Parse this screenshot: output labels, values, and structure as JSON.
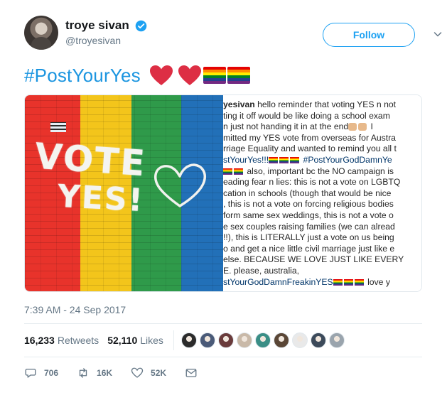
{
  "author": {
    "display_name": "troye sivan",
    "handle": "@troyesivan",
    "follow_label": "Follow"
  },
  "tweet": {
    "hashtag": "#PostYourYes",
    "emoji": [
      "heart-icon",
      "heart-icon",
      "rainbow-flag-icon",
      "rainbow-flag-icon"
    ]
  },
  "media": {
    "photo_text": [
      "VOTE",
      "YES!"
    ],
    "stripe_colors": [
      "#e8332b",
      "#f3c51b",
      "#2f9a4a",
      "#2270b8"
    ],
    "caption_lines": [
      {
        "bold": "yesivan",
        "text": " hello reminder that voting YES n not"
      },
      {
        "text": "ting it off would be like doing a school exam"
      },
      {
        "text": "n just not handing it in at the end",
        "trail": " I"
      },
      {
        "text": "mitted my YES vote from overseas for Austra"
      },
      {
        "text": "rriage Equality and wanted to remind you all t"
      },
      {
        "tag": "stYourYes!!!",
        "tag2": " #PostYourGodDamnYe"
      },
      {
        "text": " also, important bc the NO campaign is"
      },
      {
        "text": "eading fear n lies: this is not a vote on LGBTQ"
      },
      {
        "text": "cation in schools (though that would be nice"
      },
      {
        "text": ", this is not a vote on forcing religious bodies"
      },
      {
        "text": "form same sex weddings, this is not a vote o"
      },
      {
        "text": "e sex couples raising families (we can alread"
      },
      {
        "text": "!!), this is LITERALLY just a vote on us being"
      },
      {
        "text": "o and get a nice little civil marriage just like e"
      },
      {
        "text": "else. BECAUSE WE LOVE JUST LIKE EVERY"
      },
      {
        "text": "E. please, australia,"
      },
      {
        "tag": "stYourGodDamnFreakinYES",
        "trail": " love y"
      }
    ]
  },
  "timestamp": "7:39 AM - 24 Sep 2017",
  "stats": {
    "retweets_count": "16,233",
    "retweets_label": "Retweets",
    "likes_count": "52,110",
    "likes_label": "Likes",
    "liker_avatar_colors": [
      "#2b2b2b",
      "#4a5a78",
      "#6a3b3b",
      "#c9b9a8",
      "#3a8e86",
      "#5a4636",
      "#e9e9e9",
      "#3c4a5a",
      "#9aa4ad"
    ]
  },
  "actions": {
    "replies": "706",
    "retweets": "16K",
    "likes": "52K"
  },
  "colors": {
    "accent": "#1da1f2",
    "hashtag": "#1b95e0",
    "heart": "#dd2e44",
    "muted": "#657786"
  }
}
